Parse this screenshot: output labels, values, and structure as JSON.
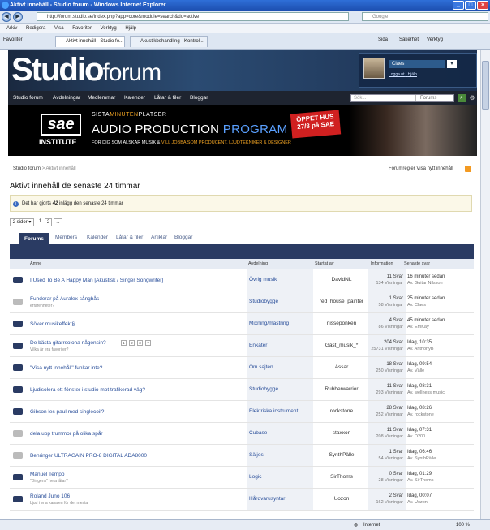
{
  "window": {
    "title": "Aktivt innehåll - Studio forum - Windows Internet Explorer",
    "address": "http://forum.studio.se/index.php?app=core&module=search&do=active",
    "search_placeholder": "Google"
  },
  "menu": [
    "Arkiv",
    "Redigera",
    "Visa",
    "Favoriter",
    "Verktyg",
    "Hjälp"
  ],
  "tabs": {
    "favorites": "Favoriter",
    "tab1": "Aktivt innehåll - Studio fo...",
    "tab2": "Akustikbehandling - Kontroll...",
    "tools": [
      "Sida",
      "Säkerhet",
      "Verktyg"
    ]
  },
  "logo": {
    "studio": "Studio",
    "forum": "forum"
  },
  "user": {
    "name": "Claes",
    "logout": "Logga ut",
    "help": "Hjälp"
  },
  "nav": [
    "Studio forum",
    "Avdelningar",
    "Medlemmar",
    "Kalender",
    "Låtar & filer",
    "Bloggar"
  ],
  "search": {
    "placeholder": "Sök...",
    "scope": "Forums"
  },
  "ad": {
    "small1": "SISTA",
    "small2": "MINUTEN",
    "small3": "PLATSER",
    "big1": "AUDIO PRODUCTION ",
    "big2": "PROGRAM",
    "sub1": "FÖR DIG SOM ÄLSKAR MUSIK & ",
    "sub2": "VILL JOBBA SOM PRODUCENT, LJUDTEKNIKER & DESIGNER",
    "oppet": "ÖPPET HUS 27/8 på SAE",
    "logo": "sae",
    "institute": "INSTITUTE"
  },
  "breadcrumb": {
    "home": "Studio forum",
    "current": "> Aktivt innehåll"
  },
  "toplinks": "Forumregler   Visa nytt innehåll",
  "heading": "Aktivt innehåll de senaste 24 timmar",
  "notice": {
    "pre": "Det har gjorts ",
    "count": "42",
    "post": " inlägg den senaste 24 timmar"
  },
  "pager": {
    "label": "2 sidor ▾",
    "p1": "1",
    "p2": "2",
    "next": "→"
  },
  "section_tabs": [
    "Forums",
    "Members",
    "Kalender",
    "Låtar & filer",
    "Artiklar",
    "Bloggar"
  ],
  "columns": {
    "topic": "Ämne",
    "forum": "Avdelning",
    "starter": "Startat av",
    "info": "Information",
    "last": "Senaste svar"
  },
  "topics": [
    {
      "title": "I Used To Be A Happy Man [Akustisk / Singer Songwriter]",
      "sub": "",
      "forum": "Övrig musik",
      "starter": "DavidNL",
      "replies": "11 Svar",
      "views": "134 Visningar",
      "last_time": "16 minuter sedan",
      "last_by": "Av. Guitar Nilsson"
    },
    {
      "title": "Funderar på Auralex sångbås",
      "sub": "erfarenheter?",
      "forum": "Studiobygge",
      "starter": "red_house_painter",
      "replies": "1 Svar",
      "views": "58 Visningar",
      "last_time": "25 minuter sedan",
      "last_by": "Av. Claes"
    },
    {
      "title": "Söker musikeffekt§",
      "sub": "",
      "forum": "Mixning/mastring",
      "starter": "nisseponken",
      "replies": "4 Svar",
      "views": "86 Visningar",
      "last_time": "45 minuter sedan",
      "last_by": "Av. EmKay"
    },
    {
      "title": "De bästa gitarrsolona någonsin?",
      "sub": "Vilka är era favoriter?",
      "forum": "Enkäter",
      "starter": "Gast_musik_*",
      "replies": "204 Svar",
      "views": "25731 Visningar",
      "last_time": "Idag, 10:35",
      "last_by": "Av. AnthonyB"
    },
    {
      "title": "\"Visa nytt innehåll\" funkar inte?",
      "sub": "",
      "forum": "Om sajten",
      "starter": "Assar",
      "replies": "18 Svar",
      "views": "250 Visningar",
      "last_time": "Idag, 09:54",
      "last_by": "Av. Välle"
    },
    {
      "title": "Ljudisolera ett fönster i studio mot trafikerad väg?",
      "sub": "",
      "forum": "Studiobygge",
      "starter": "Rubberwarrior",
      "replies": "11 Svar",
      "views": "293 Visningar",
      "last_time": "Idag, 08:31",
      "last_by": "Av. wellness music"
    },
    {
      "title": "Gibson les paul med singlecoil?",
      "sub": "",
      "forum": "Elektriska instrument",
      "starter": "rockstone",
      "replies": "28 Svar",
      "views": "252 Visningar",
      "last_time": "Idag, 08:26",
      "last_by": "Av. rockstone"
    },
    {
      "title": "dela upp trummor på olika spår",
      "sub": "",
      "forum": "Cubase",
      "starter": "staxxon",
      "replies": "11 Svar",
      "views": "208 Visningar",
      "last_time": "Idag, 07:31",
      "last_by": "Av. D200"
    },
    {
      "title": "Behringer ULTRAGAIN PRO-8 DIGITAL ADA8000",
      "sub": "",
      "forum": "Säljes",
      "starter": "SynthPälle",
      "replies": "1 Svar",
      "views": "54 Visningar",
      "last_time": "Idag, 06:46",
      "last_by": "Av. SynthPälle"
    },
    {
      "title": "Manuel Tempo",
      "sub": "\"Dingens\" heta låtar?",
      "forum": "Logic",
      "starter": "SirThoms",
      "replies": "0 Svar",
      "views": "28 Visningar",
      "last_time": "Idag, 01:29",
      "last_by": "Av. SirThoms"
    },
    {
      "title": "Roland Juno 106",
      "sub": "Ljud i ena kanalen för det mesta",
      "forum": "Hårdvarusyntar",
      "starter": "Uozon",
      "replies": "2 Svar",
      "views": "162 Visningar",
      "last_time": "Idag, 00:07",
      "last_by": "Av. Uozon"
    }
  ],
  "statusbar": {
    "zone": "Internet",
    "zoom": "100 %"
  }
}
